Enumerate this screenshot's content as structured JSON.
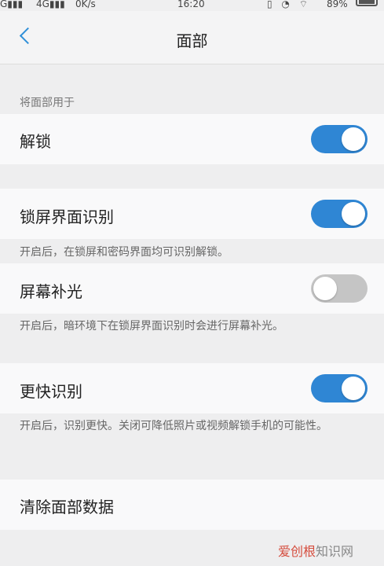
{
  "status_bar": {
    "signal1": "G▮▮▮",
    "signal2": "4G▮▮▮",
    "speed": "0K/s",
    "time": "16:20",
    "icons": "▯ ◔ ⌔",
    "battery_pct": "89%"
  },
  "nav": {
    "title": "面部"
  },
  "section_label": "将面部用于",
  "rows": [
    {
      "label": "解锁",
      "toggle": "on"
    },
    {
      "label": "锁屏界面识别",
      "toggle": "on",
      "description": "开启后，在锁屏和密码界面均可识别解锁。"
    },
    {
      "label": "屏幕补光",
      "toggle": "off",
      "description": "开启后，暗环境下在锁屏界面识别时会进行屏幕补光。"
    },
    {
      "label": "更快识别",
      "toggle": "on",
      "description": "开启后，识别更快。关闭可降低照片或视频解锁手机的可能性。"
    },
    {
      "label": "清除面部数据"
    }
  ],
  "watermark": {
    "brand": "爱创根",
    "rest": "知识网"
  },
  "colors": {
    "accent": "#2f86d4",
    "toggle_off": "#c5c5c5",
    "background": "#eeeeef"
  }
}
